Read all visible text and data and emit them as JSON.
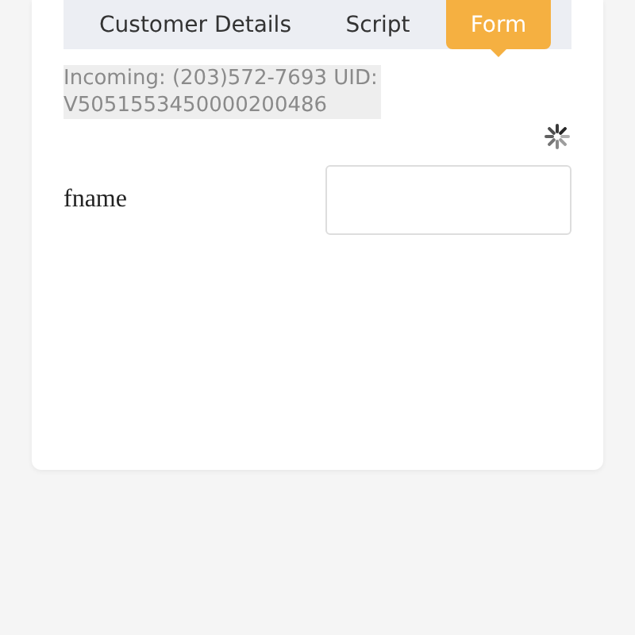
{
  "tabs": [
    {
      "label": "Customer Details",
      "selected": false
    },
    {
      "label": "Script",
      "selected": false
    },
    {
      "label": "Form",
      "selected": true
    }
  ],
  "call_info": "Incoming: (203)572-7693 UID: V5051553450000200486",
  "loading": true,
  "form": {
    "fields": [
      {
        "label": "fname"
      }
    ]
  }
}
